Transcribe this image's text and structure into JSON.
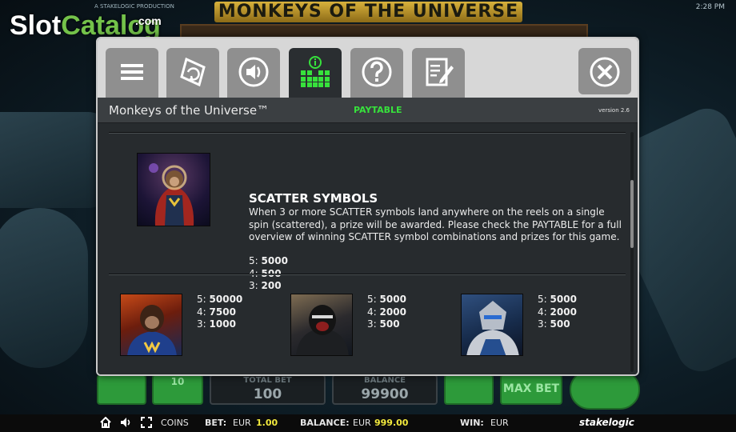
{
  "watermark": {
    "slot": "Slot",
    "catalog": "Catalog",
    "com": ".com"
  },
  "game_bg": {
    "producer": "A STAKELOGIC PRODUCTION",
    "logo": "MONKEYS OF THE UNIVERSE",
    "clock": "2:28 PM"
  },
  "controls_behind": {
    "lines_value": "10",
    "total_bet_label": "TOTAL BET",
    "total_bet_value": "100",
    "balance_label": "BALANCE",
    "balance_value": "99900",
    "max_bet_label": "MAX BET"
  },
  "dialog": {
    "tabs": [
      {
        "name": "menu",
        "icon": "hamburger-menu-icon",
        "active": false
      },
      {
        "name": "autoplay",
        "icon": "autoplay-settings-icon",
        "active": false
      },
      {
        "name": "sound",
        "icon": "speaker-icon",
        "active": false
      },
      {
        "name": "paytable",
        "icon": "info-paytable-icon",
        "active": true
      },
      {
        "name": "help",
        "icon": "question-icon",
        "active": false
      },
      {
        "name": "history",
        "icon": "notepad-edit-icon",
        "active": false
      }
    ],
    "close_icon": "close-x-icon",
    "game_title": "Monkeys of the Universe™",
    "section_title": "PAYTABLE",
    "version": "version 2.6",
    "scatter": {
      "heading": "SCATTER SYMBOLS",
      "description": "When 3 or more SCATTER symbols land anywhere on the reels on a single spin (scattered), a prize will be awarded. Please check the PAYTABLE for a full overview of winning SCATTER symbol combinations and prizes for this game.",
      "pays": [
        {
          "count": "5:",
          "value": "5000"
        },
        {
          "count": "4:",
          "value": "500"
        },
        {
          "count": "3:",
          "value": "200"
        }
      ]
    },
    "symbols": [
      {
        "name": "chimp-captain",
        "pays": [
          {
            "count": "5:",
            "value": "50000"
          },
          {
            "count": "4:",
            "value": "7500"
          },
          {
            "count": "3:",
            "value": "1000"
          }
        ]
      },
      {
        "name": "gorilla-warrior",
        "pays": [
          {
            "count": "5:",
            "value": "5000"
          },
          {
            "count": "4:",
            "value": "2000"
          },
          {
            "count": "3:",
            "value": "500"
          }
        ]
      },
      {
        "name": "armored-monkey",
        "pays": [
          {
            "count": "5:",
            "value": "5000"
          },
          {
            "count": "4:",
            "value": "2000"
          },
          {
            "count": "3:",
            "value": "500"
          }
        ]
      }
    ]
  },
  "statusbar": {
    "coins": "COINS",
    "bet_label": "BET:",
    "bet_currency": "EUR",
    "bet_value": "1.00",
    "balance_label": "BALANCE:",
    "balance_currency": "EUR",
    "balance_value": "999.00",
    "win_label": "WIN:",
    "win_currency": "EUR",
    "brand": "stakelogic"
  },
  "colors": {
    "accent_green": "#37e23c",
    "value_yellow": "#f3ea3d",
    "tab_active": "#2a2e31",
    "tab_inactive": "#8f8f8f"
  }
}
